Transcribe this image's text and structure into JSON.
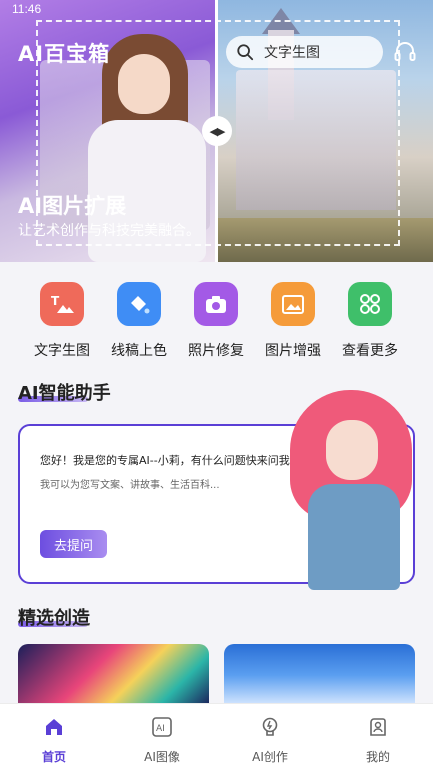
{
  "status": {
    "time": "11:46"
  },
  "header": {
    "app_title": "AI百宝箱",
    "search_placeholder": "文字生图"
  },
  "hero": {
    "title": "AI图片扩展",
    "subtitle": "让艺术创作与科技完美融合。"
  },
  "tools": [
    {
      "label": "文字生图",
      "icon": "text-to-image-icon",
      "color": "#ef6a5a"
    },
    {
      "label": "线稿上色",
      "icon": "paint-bucket-icon",
      "color": "#3f8df5"
    },
    {
      "label": "照片修复",
      "icon": "camera-repair-icon",
      "color": "#a35ae6"
    },
    {
      "label": "图片增强",
      "icon": "hd-image-icon",
      "color": "#f59b3a"
    },
    {
      "label": "查看更多",
      "icon": "more-grid-icon",
      "color": "#3fbf6a"
    }
  ],
  "ai_assistant": {
    "section_title": "AI智能助手",
    "greeting": "您好！我是您的专属AI--小莉，有什么问题快来问我吧~",
    "description": "我可以为您写文案、讲故事、生活百科...",
    "ask_button": "去提问"
  },
  "featured": {
    "section_title": "精选创造"
  },
  "tabbar": [
    {
      "label": "首页",
      "icon": "home-icon",
      "active": true
    },
    {
      "label": "AI图像",
      "icon": "ai-image-icon",
      "active": false
    },
    {
      "label": "AI创作",
      "icon": "ai-create-icon",
      "active": false
    },
    {
      "label": "我的",
      "icon": "profile-icon",
      "active": false
    }
  ],
  "colors": {
    "accent": "#5a3fd6",
    "background": "#f4f4f8"
  }
}
